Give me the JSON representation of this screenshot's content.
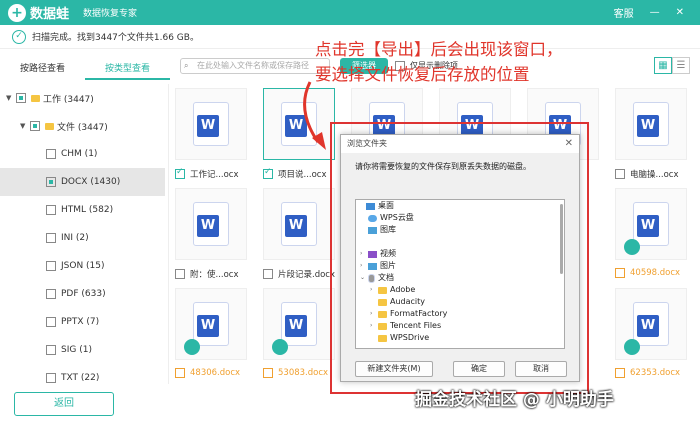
{
  "titlebar": {
    "logo_symbol": "+",
    "app_name": "数据蛙",
    "subtitle": "数据恢复专家",
    "support_label": "客服",
    "minimize": "—",
    "close": "✕",
    "accent": "#2bb7a6"
  },
  "status": {
    "message": "扫描完成。找到3447个文件共1.66 GB。"
  },
  "tabs": [
    {
      "label": "按路径查看"
    },
    {
      "label": "按类型查看"
    }
  ],
  "toolbar": {
    "search_placeholder": "在此处输入文件名称或保存路径",
    "filter_label": "筛选器",
    "deleted_only_label": "仅显示删除项"
  },
  "tree": {
    "items": [
      {
        "label": "工作 (3447)"
      },
      {
        "label": "文件 (3447)"
      },
      {
        "label": "CHM (1)"
      },
      {
        "label": "DOCX (1430)"
      },
      {
        "label": "HTML (582)"
      },
      {
        "label": "INI (2)"
      },
      {
        "label": "JSON (15)"
      },
      {
        "label": "PDF (633)"
      },
      {
        "label": "PPTX (7)"
      },
      {
        "label": "SIG (1)"
      },
      {
        "label": "TXT (22)"
      }
    ]
  },
  "back_label": "返回",
  "files": {
    "r1": [
      "工作记...ocx",
      "项目说...ocx",
      "电脑操...ocx"
    ],
    "r2": [
      "附：使...ocx",
      "片段记录.docx",
      "40598.docx"
    ],
    "r3": [
      "48306.docx",
      "53083.docx",
      "62353.docx"
    ]
  },
  "annotation": {
    "line1": "点击完【导出】后会出现该窗口，",
    "line2": "要选择文件恢复后存放的位置"
  },
  "dialog": {
    "title": "浏览文件夹",
    "message": "请你将需要恢复的文件保存到原丢失数据的磁盘。",
    "folders": {
      "desktop": "桌面",
      "wps": "WPS云盘",
      "gallery": "图库",
      "video": "视频",
      "pictures": "图片",
      "documents": "文档",
      "adobe": "Adobe",
      "audacity": "Audacity",
      "formatfactory": "FormatFactory",
      "tencent": "Tencent Files",
      "wpsdrive": "WPSDrive"
    },
    "new_folder_label": "新建文件夹(M)",
    "ok_label": "确定",
    "cancel_label": "取消"
  },
  "watermark": "掘金技术社区 @ 小明助手"
}
